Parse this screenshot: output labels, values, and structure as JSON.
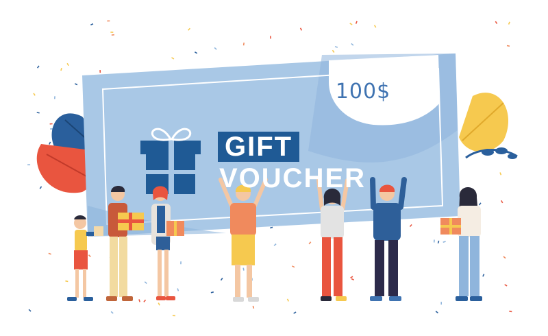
{
  "voucher": {
    "amount": "100$",
    "title_line1": "GIFT",
    "title_line2": "VOUCHER"
  },
  "colors": {
    "voucher_light": "#a9c8e6",
    "voucher_mid": "#8fb5dc",
    "voucher_dark": "#1f5a95",
    "leaf_red": "#e9553f",
    "leaf_blue": "#2a5f9c",
    "leaf_yellow": "#f6c94f",
    "shirt_orange": "#f08a5d",
    "shirt_blue": "#2e5f99"
  },
  "icons": [
    "gift-box-icon",
    "leaf-icon",
    "confetti"
  ]
}
